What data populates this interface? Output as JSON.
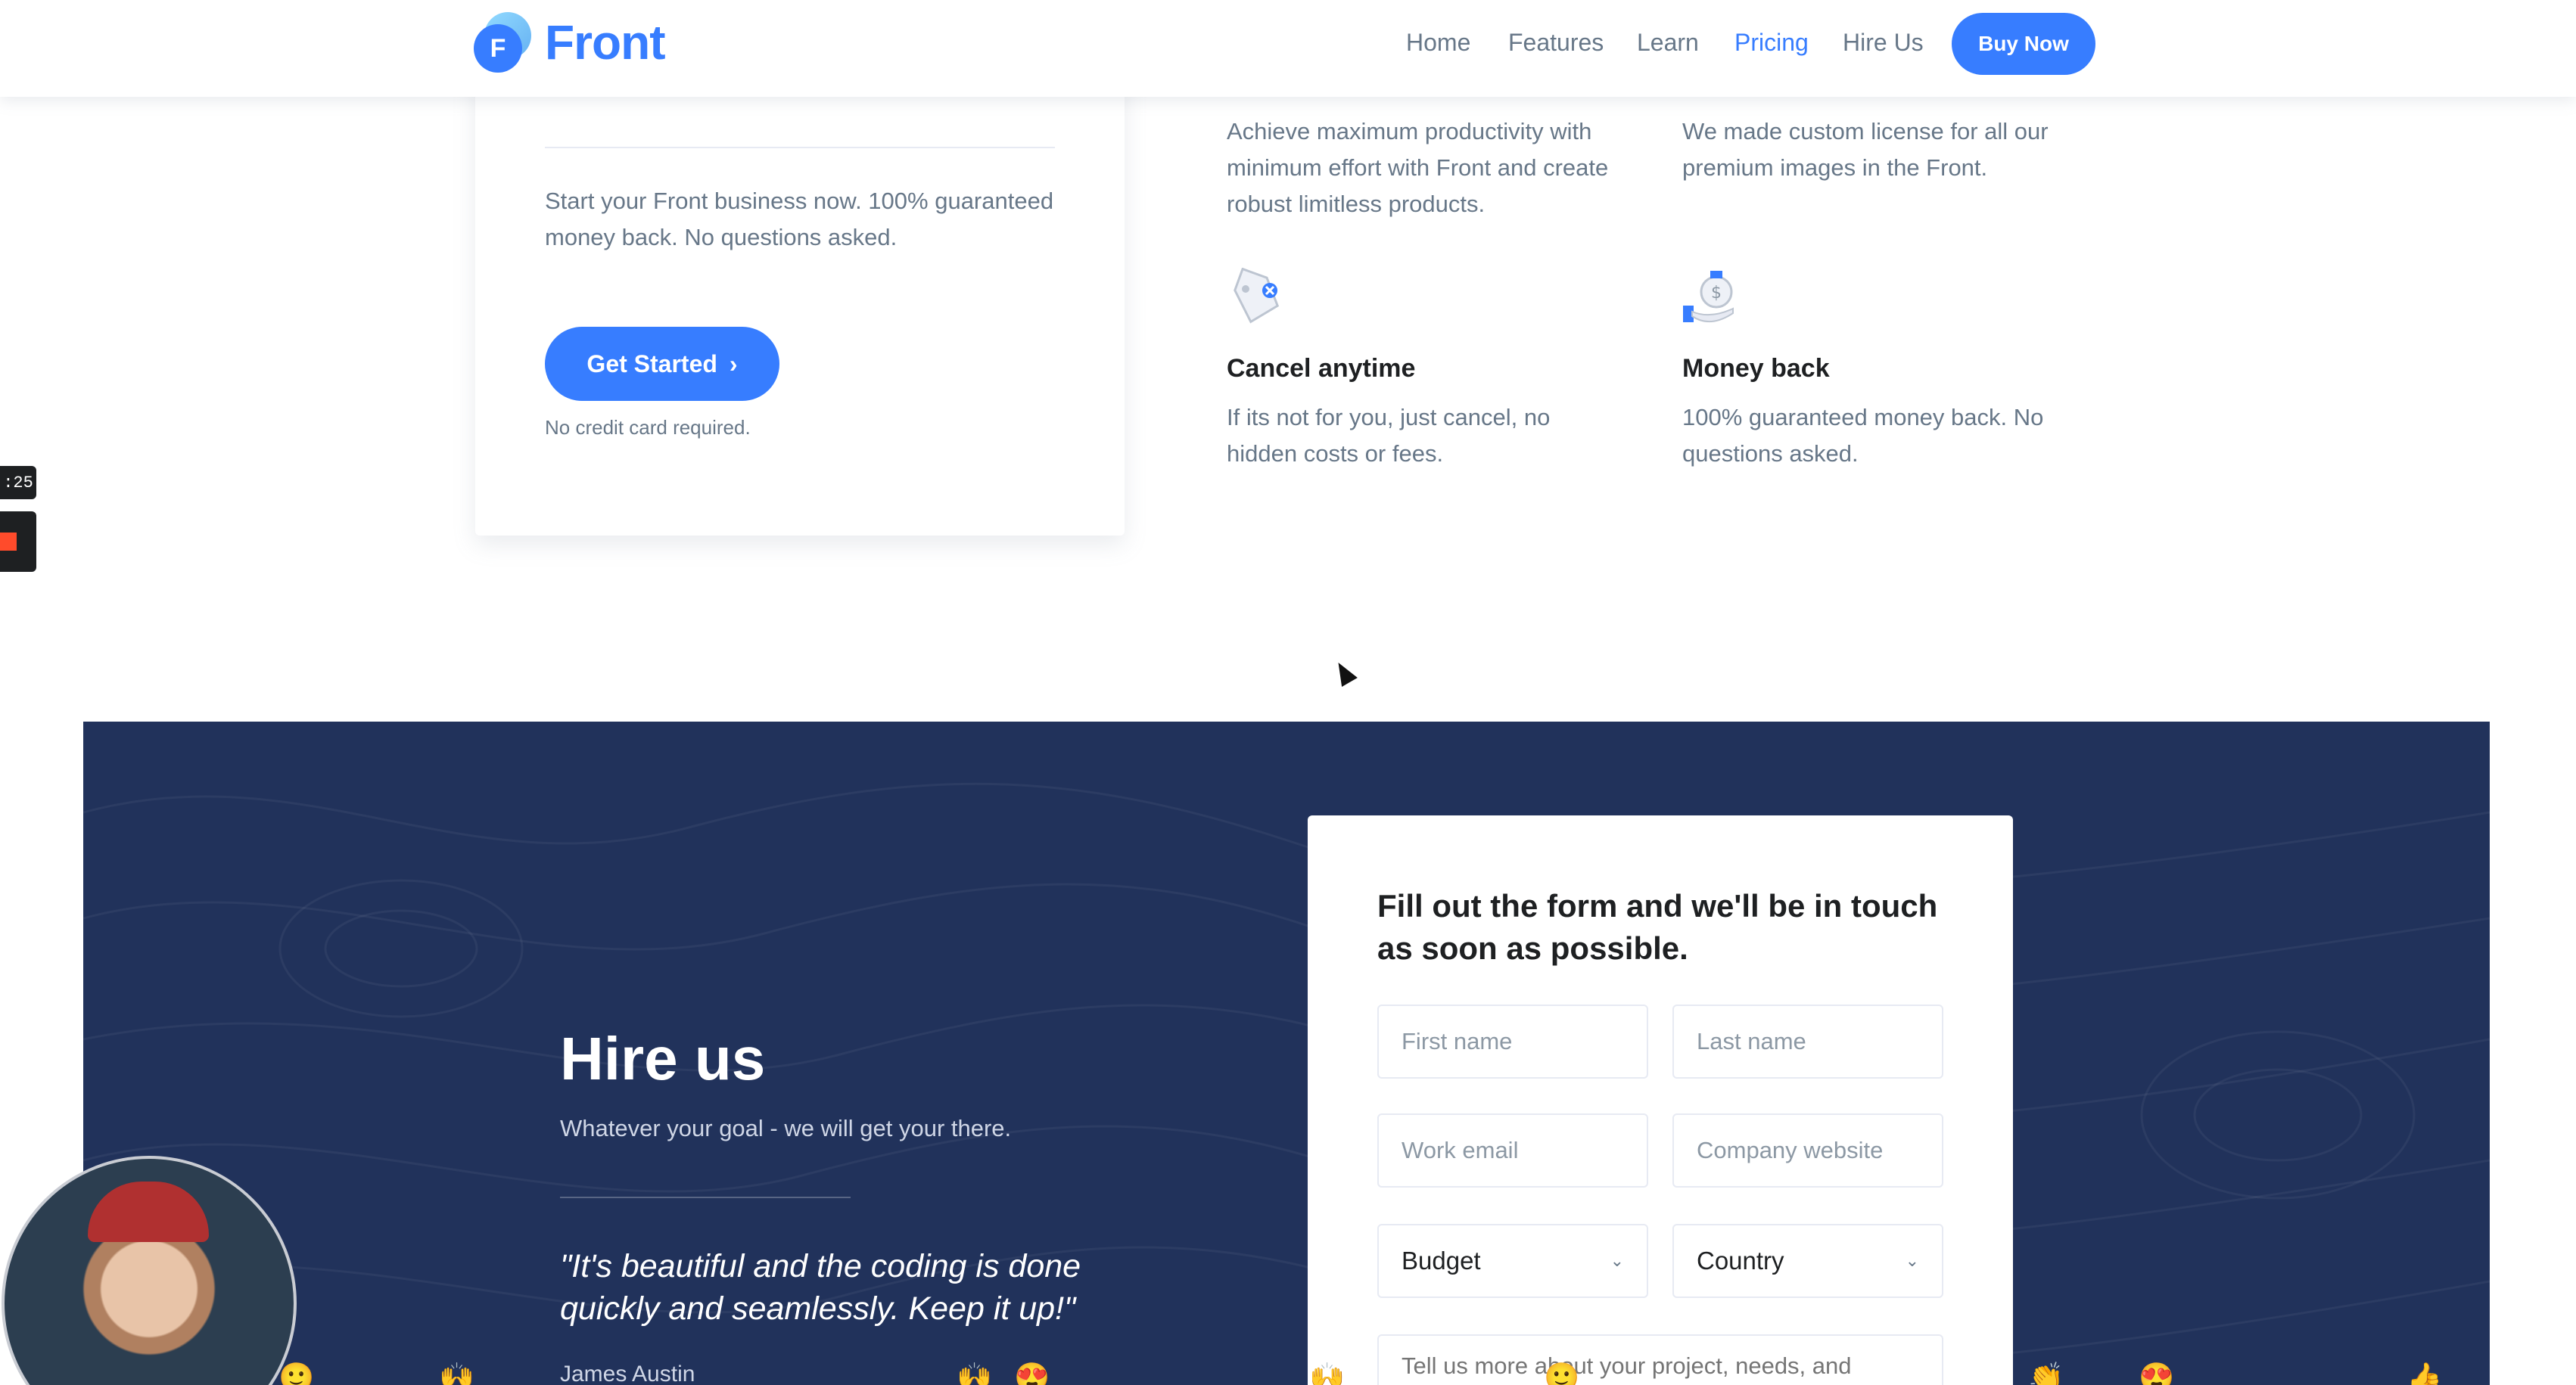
{
  "header": {
    "logo_text": "Front",
    "logo_letter": "F",
    "nav": [
      {
        "label": "Home",
        "active": false
      },
      {
        "label": "Features",
        "active": false
      },
      {
        "label": "Learn",
        "active": false
      },
      {
        "label": "Pricing",
        "active": true
      },
      {
        "label": "Hire Us",
        "active": false
      }
    ],
    "buy_now_label": "Buy Now"
  },
  "pricing_card": {
    "description": "Start your Front business now. 100% guaranteed money back. No questions asked.",
    "cta_label": "Get Started",
    "cta_icon": "chevron-right-icon",
    "note": "No credit card required."
  },
  "features": [
    {
      "title": "",
      "text": "Achieve maximum productivity with minimum effort with Front and create robust limitless products."
    },
    {
      "title": "",
      "text": "We made custom license for all our premium images in the Front."
    },
    {
      "title": "Cancel anytime",
      "text": "If its not for you, just cancel, no hidden costs or fees.",
      "icon": "tag-cancel-icon"
    },
    {
      "title": "Money back",
      "text": "100% guaranteed money back. No questions asked.",
      "icon": "money-bag-icon"
    }
  ],
  "recorder": {
    "time": ":25"
  },
  "hire": {
    "title": "Hire us",
    "subtitle": "Whatever your goal - we will get your there.",
    "quote": "\"It's beautiful and the coding is done quickly and seamlessly. Keep it up!\"",
    "author": "James Austin"
  },
  "form": {
    "title": "Fill out the form and we'll be in touch as soon as possible.",
    "first_name_placeholder": "First name",
    "last_name_placeholder": "Last name",
    "email_placeholder": "Work email",
    "website_placeholder": "Company website",
    "budget_label": "Budget",
    "country_label": "Country",
    "message_placeholder": "Tell us more about your project, needs, and"
  },
  "colors": {
    "primary": "#377dff",
    "navy": "#21325b",
    "text_muted": "#677788"
  }
}
